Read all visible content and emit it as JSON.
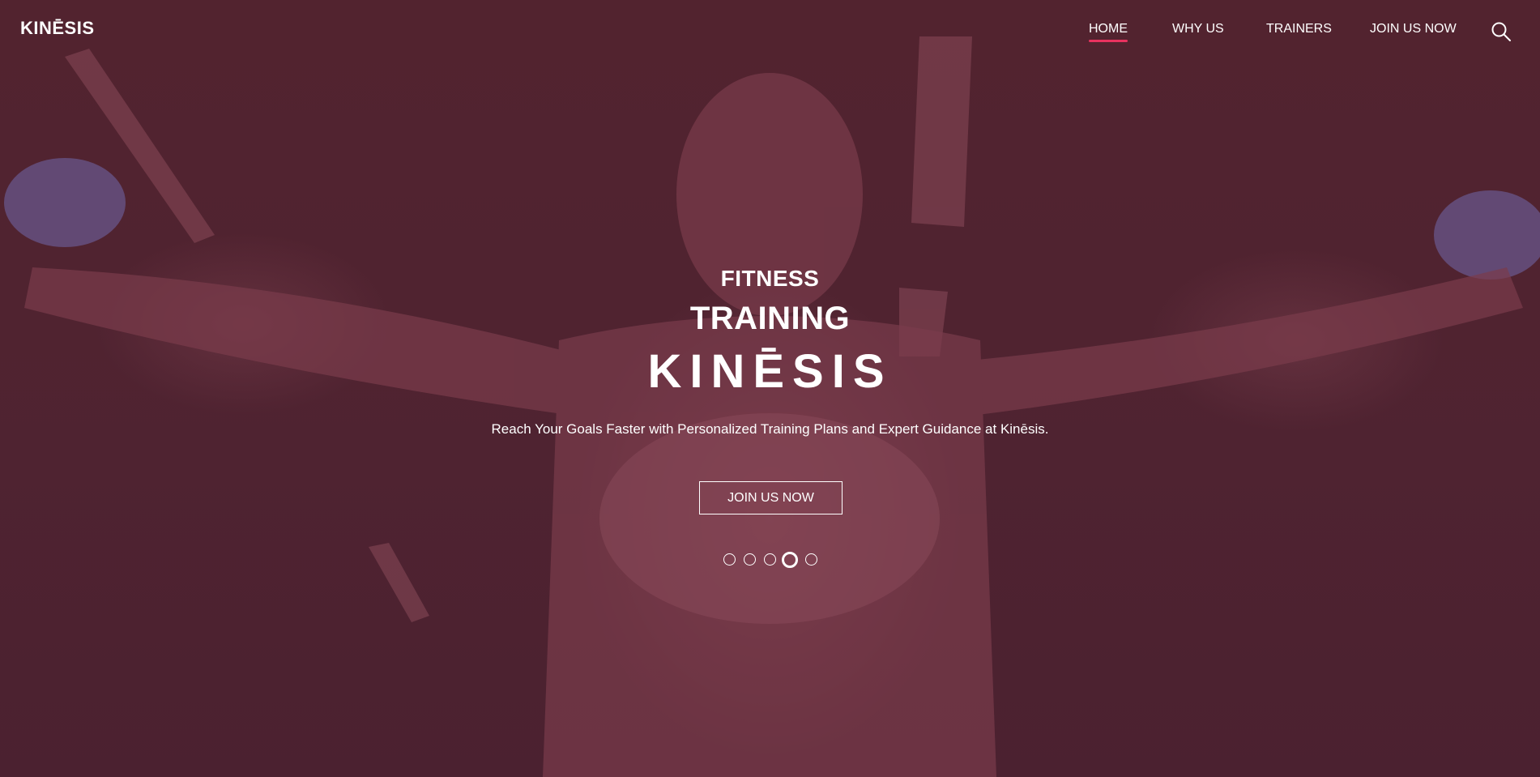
{
  "brand": {
    "logo_text": "KINĒSIS"
  },
  "nav": {
    "items": [
      {
        "label": "HOME",
        "active": true
      },
      {
        "label": "WHY US",
        "active": false
      },
      {
        "label": "TRAINERS",
        "active": false
      },
      {
        "label": "JOIN US NOW",
        "active": false
      }
    ],
    "search_icon": "search-icon",
    "active_underline_color": "#e8325f"
  },
  "hero": {
    "eyebrow": "FITNESS",
    "headline": "TRAINING",
    "brand_name": "KINĒSIS",
    "tagline": "Reach Your Goals Faster with Personalized Training Plans and Expert Guidance at Kinēsis.",
    "cta_label": "JOIN US NOW",
    "overlay_color": "#4f2331",
    "slider": {
      "count": 5,
      "active_index": 3
    }
  }
}
